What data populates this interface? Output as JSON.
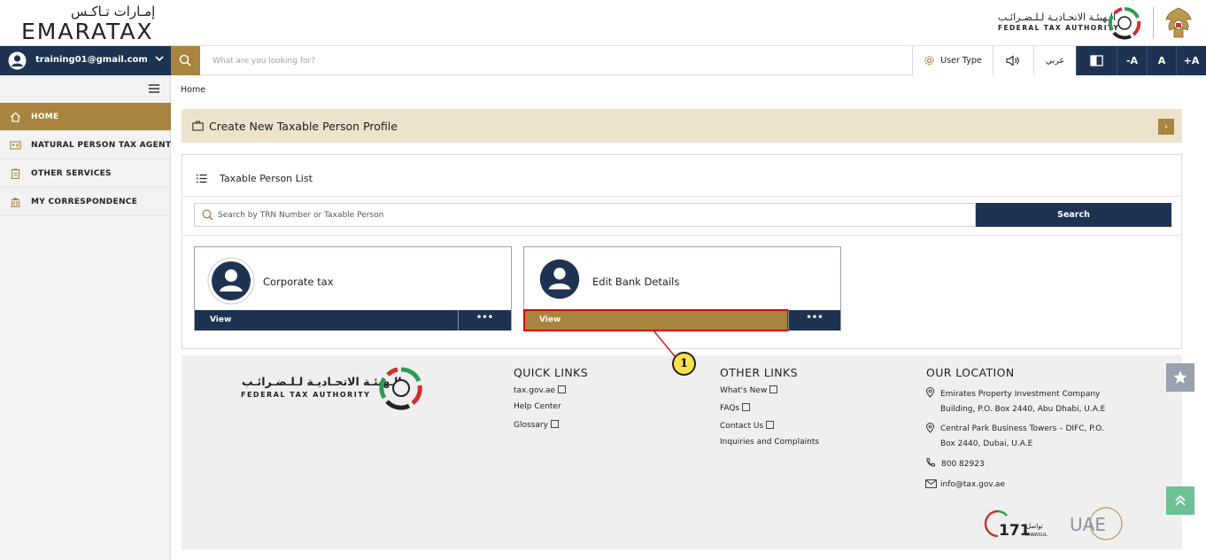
{
  "header": {
    "logo_arabic": "إمـارات تـاكـس",
    "logo_english": "EMARATAX",
    "fta_arabic": "الـهيئـة الاتحـاديـة لـلـضـرائـب",
    "fta_english": "FEDERAL TAX AUTHORITY"
  },
  "navbar": {
    "user_email": "training01@gmail.com",
    "search_placeholder": "What are you looking for?",
    "user_type_label": "User Type",
    "arabic_label": "عربي",
    "font_decrease": "-A",
    "font_normal": "A",
    "font_increase": "+A"
  },
  "sidebar": {
    "items": [
      {
        "label": "HOME",
        "icon": "home-icon"
      },
      {
        "label": "NATURAL PERSON TAX AGENT",
        "icon": "id-card-icon"
      },
      {
        "label": "OTHER SERVICES",
        "icon": "clipboard-icon"
      },
      {
        "label": "MY CORRESPONDENCE",
        "icon": "bank-icon"
      }
    ]
  },
  "main": {
    "breadcrumb": "Home",
    "create_profile": "Create New Taxable Person Profile",
    "list_title": "Taxable Person List",
    "search_placeholder": "Search by TRN Number or Taxable Person",
    "search_button": "Search",
    "cards": [
      {
        "name": "Corporate tax",
        "view_label": "View",
        "more": "•••"
      },
      {
        "name": "Edit Bank Details",
        "view_label": "View",
        "more": "•••"
      }
    ]
  },
  "footer": {
    "fta_arabic": "الـهيئـة الاتحـاديـة لـلـضـرائـب",
    "fta_english": "FEDERAL TAX AUTHORITY",
    "quick_links": {
      "title": "QUICK LINKS",
      "items": [
        "tax.gov.ae",
        "Help Center",
        "Glossary"
      ]
    },
    "other_links": {
      "title": "OTHER LINKS",
      "items": [
        "What's New",
        "FAQs",
        "Contact Us",
        "Inquiries and Complaints"
      ]
    },
    "location": {
      "title": "OUR LOCATION",
      "address1_line1": "Emirates Property Investment Company",
      "address1_line2": "Building, P.O. Box 2440, Abu Dhabi, U.A.E",
      "address2_line1": "Central Park Business Towers – DIFC, P.O.",
      "address2_line2": "Box 2440, Dubai, U.A.E",
      "phone": "800 82923",
      "email": "info@tax.gov.ae"
    },
    "tawasul_number": "171",
    "tawasul_ar": "تواصل",
    "tawasul_en": "TAWASUL",
    "uae_logo": "UAE"
  },
  "callout": {
    "number": "1"
  },
  "colors": {
    "navy": "#1e3352",
    "gold": "#a8843e",
    "highlight": "#e00000"
  }
}
